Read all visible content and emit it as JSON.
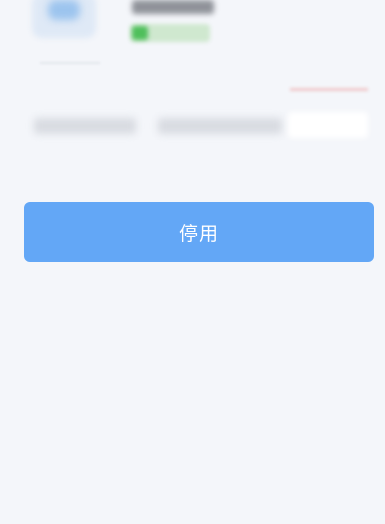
{
  "actions": {
    "disable_label": "停用"
  },
  "colors": {
    "page_background": "#f4f6fa",
    "primary_button": "#63a7f6",
    "primary_button_text": "#ffffff",
    "status_green": "#4fbf5b"
  }
}
